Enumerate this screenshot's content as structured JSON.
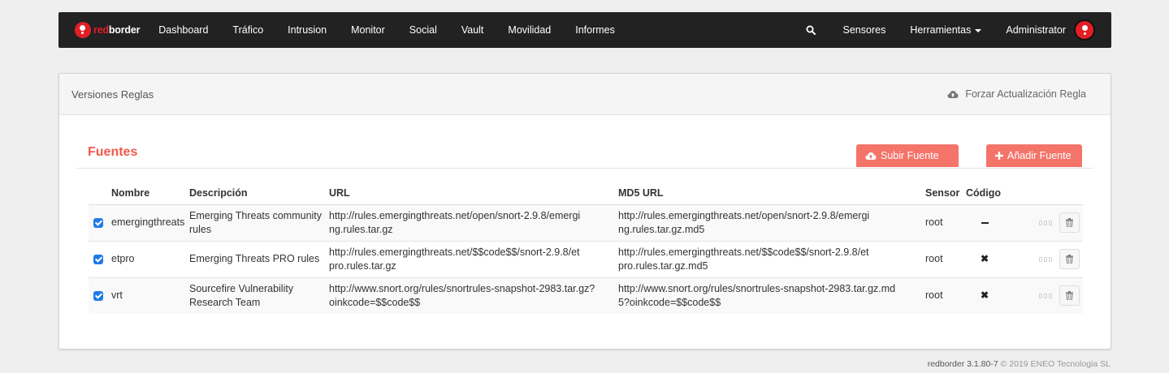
{
  "navbar": {
    "brand_red": "red",
    "brand_white": "border",
    "items": [
      "Dashboard",
      "Tráfico",
      "Intrusion",
      "Monitor",
      "Social",
      "Vault",
      "Movilidad",
      "Informes"
    ],
    "sensors": "Sensores",
    "tools": "Herramientas",
    "admin": "Administrator"
  },
  "panel": {
    "title": "Versiones Reglas",
    "force_update": "Forzar Actualización Regla"
  },
  "section": {
    "title": "Fuentes",
    "upload_button": "Subir Fuente",
    "add_button": "Añadir Fuente"
  },
  "table": {
    "headers": [
      "Nombre",
      "Descripción",
      "URL",
      "MD5 URL",
      "Sensor",
      "Código"
    ],
    "rows": [
      {
        "checked": true,
        "name": "emergingthreats",
        "description": "Emerging Threats community rules",
        "url": "http://rules.emergingthreats.net/open/snort-2.9.8/emerging.rules.tar.gz",
        "md5_url": "http://rules.emergingthreats.net/open/snort-2.9.8/emerging.rules.tar.gz.md5",
        "sensor": "root",
        "code": "dash"
      },
      {
        "checked": true,
        "name": "etpro",
        "description": "Emerging Threats PRO rules",
        "url": "http://rules.emergingthreats.net/$$code$$/snort-2.9.8/etpro.rules.tar.gz",
        "md5_url": "http://rules.emergingthreats.net/$$code$$/snort-2.9.8/etpro.rules.tar.gz.md5",
        "sensor": "root",
        "code": "times"
      },
      {
        "checked": true,
        "name": "vrt",
        "description": "Sourcefire Vulnerability Research Team",
        "url": "http://www.snort.org/rules/snortrules-snapshot-2983.tar.gz?oinkcode=$$code$$",
        "md5_url": "http://www.snort.org/rules/snortrules-snapshot-2983.tar.gz.md5?oinkcode=$$code$$",
        "sensor": "root",
        "code": "times"
      }
    ]
  },
  "footer": {
    "product": "redborder 3.1.80-7",
    "copyright": "© 2019 ENEO Tecnologia SL"
  },
  "colors": {
    "navbar_bg": "#222222",
    "brand_red": "#e21e25",
    "accent": "#f05a4b",
    "button": "#f4746a",
    "checkbox": "#1f7ae8"
  },
  "icons": [
    "logo-icon",
    "search-icon",
    "caret-down-icon",
    "avatar-icon",
    "cloud-upload-icon",
    "plus-icon",
    "checkbox-icon",
    "dash-icon",
    "times-icon",
    "toggle-icon",
    "trash-icon"
  ]
}
